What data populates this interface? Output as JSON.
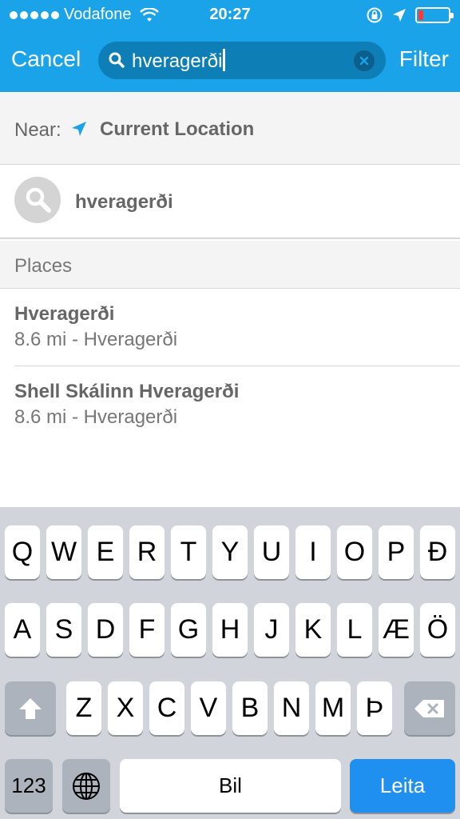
{
  "status": {
    "carrier": "Vodafone",
    "time": "20:27",
    "battery_color": "#ff3b30"
  },
  "nav": {
    "cancel": "Cancel",
    "filter": "Filter",
    "search_value": "hveragerði"
  },
  "near": {
    "label": "Near:",
    "value": "Current Location"
  },
  "suggestion": {
    "text": "hveragerði"
  },
  "section": {
    "title": "Places"
  },
  "places": [
    {
      "name": "Hveragerði",
      "detail": "8.6 mi - Hveragerði"
    },
    {
      "name": "Shell Skálinn Hveragerði",
      "detail": "8.6 mi - Hveragerði"
    }
  ],
  "keyboard": {
    "row1": [
      "Q",
      "W",
      "E",
      "R",
      "T",
      "Y",
      "U",
      "I",
      "O",
      "P",
      "Ð"
    ],
    "row2": [
      "A",
      "S",
      "D",
      "F",
      "G",
      "H",
      "J",
      "K",
      "L",
      "Æ",
      "Ö"
    ],
    "row3": [
      "Z",
      "X",
      "C",
      "V",
      "B",
      "N",
      "M",
      "Þ"
    ],
    "numbers": "123",
    "space": "Bil",
    "go": "Leita"
  },
  "colors": {
    "accent": "#1aa3e8",
    "go_key": "#1f8ff0"
  }
}
